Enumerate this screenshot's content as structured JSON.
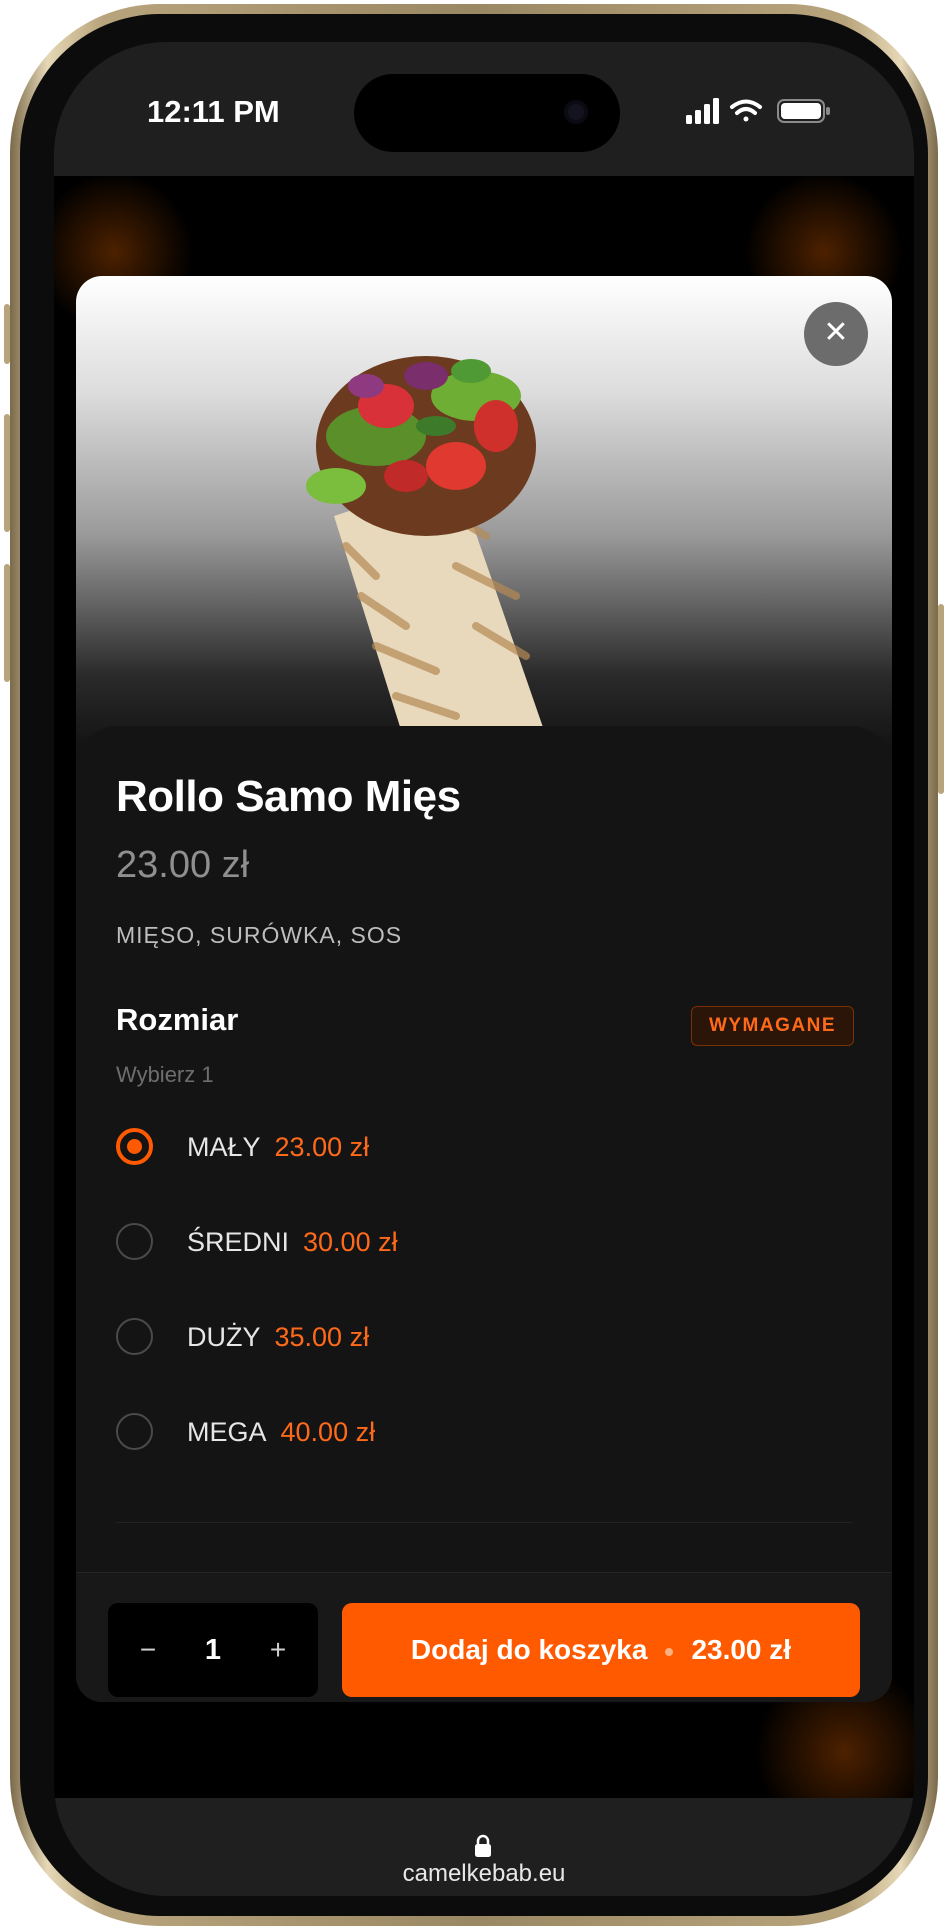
{
  "status_bar": {
    "time": "12:11 PM"
  },
  "product": {
    "name": "Rollo Samo Mięs",
    "price": "23.00 zł",
    "ingredients": "MIĘSO, SURÓWKA, SOS"
  },
  "size_group": {
    "title": "Rozmiar",
    "required_badge": "WYMAGANE",
    "subtitle": "Wybierz 1",
    "options": [
      {
        "label": "MAŁY",
        "price": "23.00 zł",
        "selected": true
      },
      {
        "label": "ŚREDNI",
        "price": "30.00 zł",
        "selected": false
      },
      {
        "label": "DUŻY",
        "price": "35.00 zł",
        "selected": false
      },
      {
        "label": "MEGA",
        "price": "40.00 zł",
        "selected": false
      }
    ]
  },
  "footer": {
    "minus": "−",
    "quantity": "1",
    "plus": "+",
    "add_label": "Dodaj do koszyka",
    "add_price": "23.00 zł"
  },
  "browser": {
    "url": "camelkebab.eu"
  },
  "colors": {
    "accent": "#ff5a00",
    "background": "#141414"
  },
  "icons": {
    "close": "close-icon",
    "lock": "lock-icon"
  }
}
